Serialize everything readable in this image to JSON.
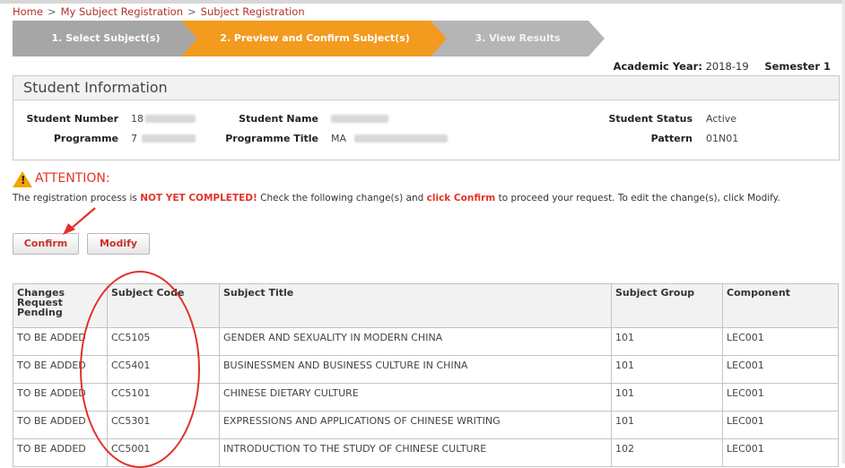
{
  "breadcrumb": [
    "Home",
    "My Subject Registration",
    "Subject Registration"
  ],
  "steps": [
    "1. Select Subject(s)",
    "2. Preview and Confirm Subject(s)",
    "3. View Results"
  ],
  "academic_year": {
    "label": "Academic Year:",
    "value": "2018-19",
    "semester": "Semester 1"
  },
  "student_info": {
    "title": "Student Information",
    "student_number_label": "Student Number",
    "student_number_value": "18",
    "programme_label": "Programme",
    "programme_value": "7",
    "student_name_label": "Student Name",
    "programme_title_label": "Programme Title",
    "programme_title_value": "MA",
    "student_status_label": "Student Status",
    "student_status_value": "Active",
    "pattern_label": "Pattern",
    "pattern_value": "01N01"
  },
  "attention": {
    "title": "ATTENTION:",
    "msg_1": "The registration process is ",
    "msg_2": "NOT YET COMPLETED!",
    "msg_3": " Check the following change(s) and ",
    "msg_4": "click Confirm",
    "msg_5": " to proceed your request. To edit the change(s), click Modify."
  },
  "buttons": {
    "confirm": "Confirm",
    "modify": "Modify"
  },
  "table": {
    "headers": [
      "Changes Request Pending",
      "Subject Code",
      "Subject Title",
      "Subject Group",
      "Component"
    ],
    "rows": [
      [
        "TO BE ADDED",
        "CC5105",
        "GENDER AND SEXUALITY IN MODERN CHINA",
        "101",
        "LEC001"
      ],
      [
        "TO BE ADDED",
        "CC5401",
        "BUSINESSMEN AND BUSINESS CULTURE IN CHINA",
        "101",
        "LEC001"
      ],
      [
        "TO BE ADDED",
        "CC5101",
        "CHINESE DIETARY CULTURE",
        "101",
        "LEC001"
      ],
      [
        "TO BE ADDED",
        "CC5301",
        "EXPRESSIONS AND APPLICATIONS OF CHINESE WRITING",
        "101",
        "LEC001"
      ],
      [
        "TO BE ADDED",
        "CC5001",
        "INTRODUCTION TO THE STUDY OF CHINESE CULTURE",
        "102",
        "LEC001"
      ]
    ]
  },
  "colors": {
    "accent": "#f39b1f",
    "link_red": "#b2322a",
    "alert_red": "#e2342a",
    "annotation_red": "#e3302a"
  }
}
